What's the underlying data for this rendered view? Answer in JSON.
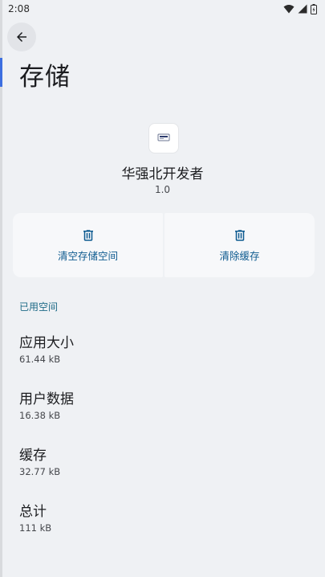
{
  "status_bar": {
    "time": "2:08"
  },
  "page": {
    "title": "存储"
  },
  "app": {
    "name": "华强北开发者",
    "version": "1.0"
  },
  "actions": {
    "clear_storage": "清空存储空间",
    "clear_cache": "清除缓存"
  },
  "section": {
    "title": "已用空间"
  },
  "stats": [
    {
      "title": "应用大小",
      "value": "61.44 kB"
    },
    {
      "title": "用户数据",
      "value": "16.38 kB"
    },
    {
      "title": "缓存",
      "value": "32.77 kB"
    },
    {
      "title": "总计",
      "value": "111 kB"
    }
  ],
  "colors": {
    "background": "#eff1f4",
    "accent": "#0d5a8f",
    "section_header": "#1d6a86"
  },
  "icons": {
    "back": "arrow-back-icon",
    "delete": "trash-icon",
    "wifi": "wifi-icon",
    "signal": "signal-icon",
    "battery": "battery-icon"
  }
}
